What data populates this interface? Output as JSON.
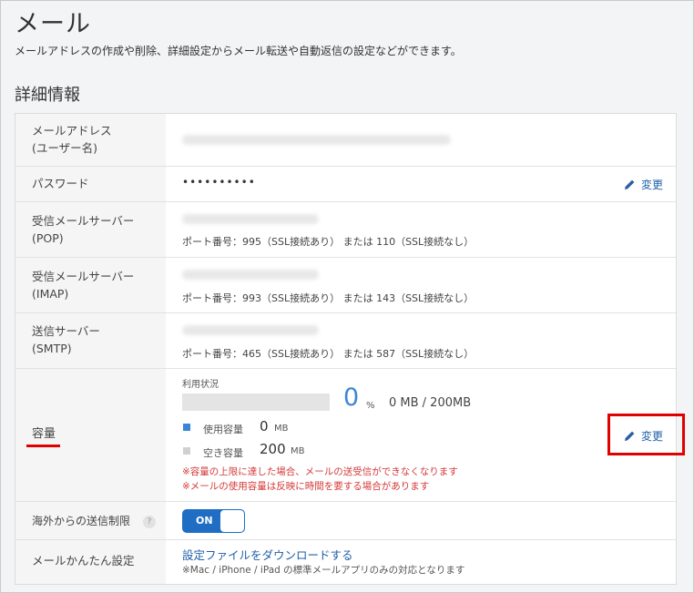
{
  "header": {
    "title": "メール",
    "description": "メールアドレスの作成や削除、詳細設定からメール転送や自動返信の設定などができます。"
  },
  "section": {
    "title": "詳細情報"
  },
  "rows": {
    "email": {
      "label_line1": "メールアドレス",
      "label_line2": "(ユーザー名)"
    },
    "password": {
      "label": "パスワード",
      "value": "••••••••••",
      "edit_label": "変更"
    },
    "pop": {
      "label_line1": "受信メールサーバー",
      "label_line2": "(POP)",
      "port": "ポート番号：995（SSL接続あり） または 110（SSL接続なし）"
    },
    "imap": {
      "label_line1": "受信メールサーバー",
      "label_line2": "(IMAP)",
      "port": "ポート番号：993（SSL接続あり） または 143（SSL接続なし）"
    },
    "smtp": {
      "label_line1": "送信サーバー",
      "label_line2": "(SMTP)",
      "port": "ポート番号：465（SSL接続あり） または 587（SSL接続なし）"
    },
    "capacity": {
      "label": "容量",
      "usage_label": "利用状況",
      "usage_percent_value": 0,
      "percent": "0",
      "percent_unit": "%",
      "usage_summary": "0 MB / 200MB",
      "used_label": "使用容量",
      "used_value": "0",
      "used_unit": "MB",
      "free_label": "空き容量",
      "free_value": "200",
      "free_unit": "MB",
      "warning1": "※容量の上限に達した場合、メールの送受信ができなくなります",
      "warning2": "※メールの使用容量は反映に時間を要する場合があります",
      "edit_label": "変更",
      "used_color": "#3a86d6",
      "free_color": "#d0d0d0"
    },
    "overseas": {
      "label": "海外からの送信制限",
      "help": "?",
      "toggle_label": "ON",
      "toggle_state": "on"
    },
    "easy_setup": {
      "label": "メールかんたん設定",
      "link": "設定ファイルをダウンロードする",
      "note": "※Mac / iPhone / iPad の標準メールアプリのみの対応となります"
    }
  },
  "colors": {
    "accent": "#1f5fa8",
    "toggle": "#1f6ec4",
    "highlight": "#e00000",
    "warning": "#d43a3a"
  }
}
